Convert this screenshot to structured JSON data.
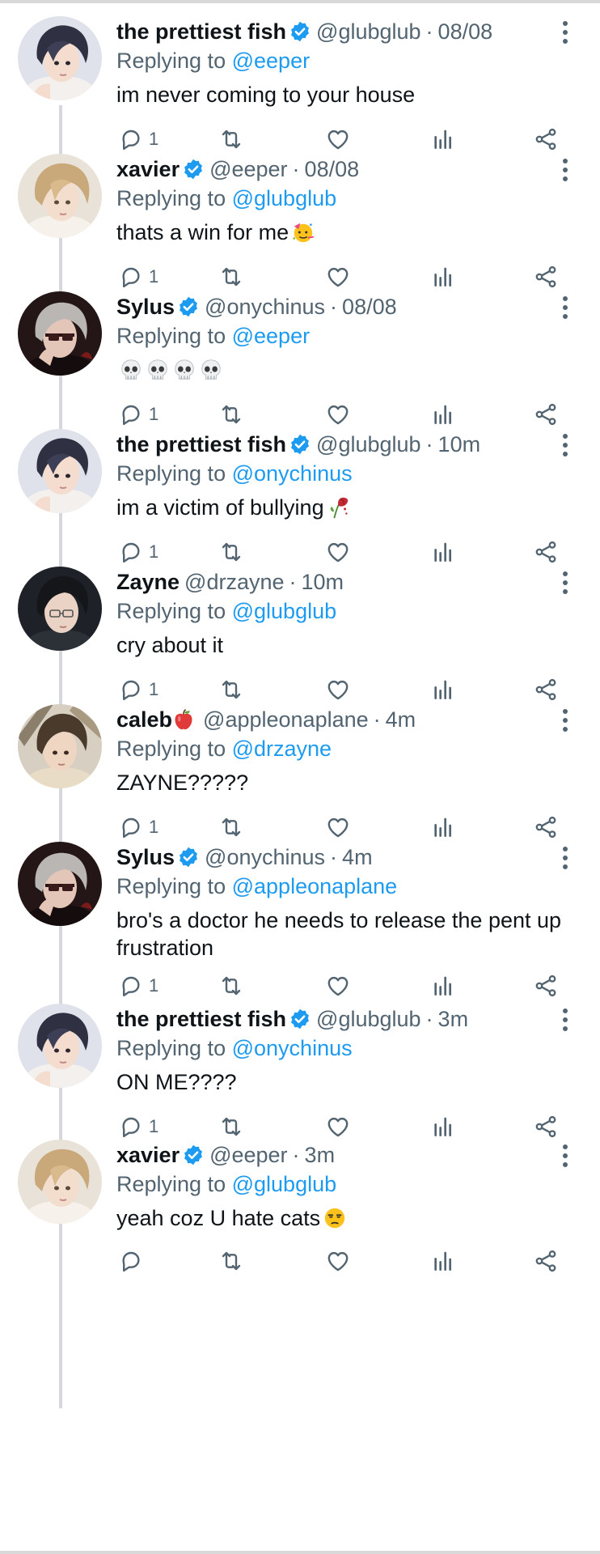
{
  "colors": {
    "link": "#1d9bf0",
    "muted": "#536471",
    "verified": "#1d9bf0",
    "text": "#0f1419"
  },
  "replying_prefix": "Replying to",
  "tweets": [
    {
      "name": "the prettiest fish",
      "verified": true,
      "handle": "@glubglub",
      "time": "08/08",
      "replying_to": "@eeper",
      "text": "im never coming to your house",
      "emoji": "",
      "reply_count": "1",
      "avatar": "fish"
    },
    {
      "name": "xavier",
      "verified": true,
      "handle": "@eeper",
      "time": "08/08",
      "replying_to": "@glubglub",
      "text": "thats a win for me",
      "emoji": "partying-face",
      "reply_count": "1",
      "avatar": "xavier"
    },
    {
      "name": "Sylus",
      "verified": true,
      "handle": "@onychinus",
      "time": "08/08",
      "replying_to": "@eeper",
      "text": "",
      "emoji": "skull-x4",
      "reply_count": "1",
      "avatar": "sylus"
    },
    {
      "name": "the prettiest fish",
      "verified": true,
      "handle": "@glubglub",
      "time": "10m",
      "replying_to": "@onychinus",
      "text": "im a victim of bullying",
      "emoji": "wilted-rose",
      "reply_count": "1",
      "avatar": "fish"
    },
    {
      "name": "Zayne",
      "verified": false,
      "handle": "@drzayne",
      "time": "10m",
      "replying_to": "@glubglub",
      "text": "cry about it",
      "emoji": "",
      "reply_count": "1",
      "avatar": "zayne"
    },
    {
      "name": "caleb",
      "verified": false,
      "name_emoji": "red-apple",
      "handle": "@appleonaplane",
      "time": "4m",
      "replying_to": "@drzayne",
      "text": "ZAYNE?????",
      "emoji": "",
      "reply_count": "1",
      "avatar": "caleb"
    },
    {
      "name": "Sylus",
      "verified": true,
      "handle": "@onychinus",
      "time": "4m",
      "replying_to": "@appleonaplane",
      "text": "bro's a doctor he needs to release the pent up frustration",
      "emoji": "",
      "reply_count": "1",
      "avatar": "sylus"
    },
    {
      "name": "the prettiest fish",
      "verified": true,
      "handle": "@glubglub",
      "time": "3m",
      "replying_to": "@onychinus",
      "text": "ON ME????",
      "emoji": "",
      "reply_count": "1",
      "avatar": "fish"
    },
    {
      "name": "xavier",
      "verified": true,
      "handle": "@eeper",
      "time": "3m",
      "replying_to": "@glubglub",
      "text": "yeah coz U hate cats",
      "emoji": "unamused-face",
      "reply_count": "",
      "avatar": "xavier"
    }
  ]
}
